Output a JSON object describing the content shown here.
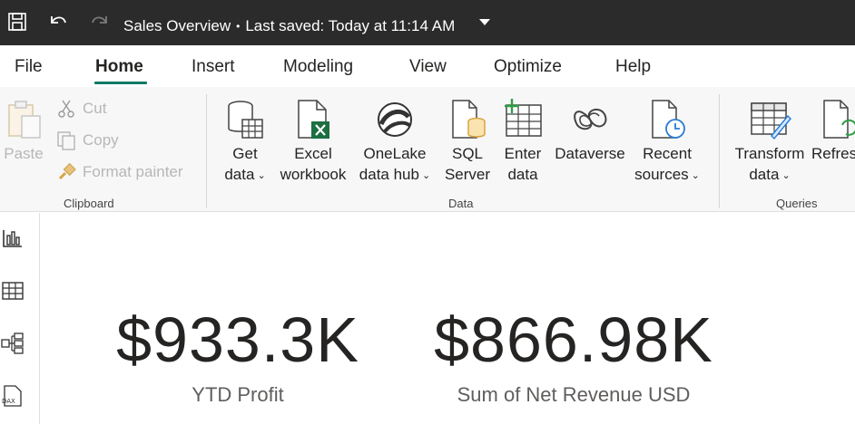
{
  "titlebar": {
    "doc_name": "Sales Overview",
    "separator": "•",
    "saved_text": "Last saved: Today at 11:14 AM"
  },
  "menu": {
    "tabs": [
      {
        "label": "File"
      },
      {
        "label": "Home",
        "active": true
      },
      {
        "label": "Insert"
      },
      {
        "label": "Modeling"
      },
      {
        "label": "View"
      },
      {
        "label": "Optimize"
      },
      {
        "label": "Help"
      }
    ]
  },
  "ribbon": {
    "clipboard": {
      "paste": "Paste",
      "cut": "Cut",
      "copy": "Copy",
      "format_painter": "Format painter",
      "group_label": "Clipboard"
    },
    "data": {
      "get_data": [
        "Get",
        "data"
      ],
      "excel": [
        "Excel",
        "workbook"
      ],
      "onelake": [
        "OneLake",
        "data hub"
      ],
      "sql": [
        "SQL",
        "Server"
      ],
      "enter_data": [
        "Enter",
        "data"
      ],
      "dataverse": "Dataverse",
      "recent": [
        "Recent",
        "sources"
      ],
      "group_label": "Data"
    },
    "queries": {
      "transform": [
        "Transform",
        "data"
      ],
      "refresh": "Refres",
      "group_label": "Queries"
    }
  },
  "kpis": [
    {
      "value": "$933.3K",
      "label": "YTD Profit"
    },
    {
      "value": "$866.98K",
      "label": "Sum of Net Revenue USD"
    }
  ],
  "colors": {
    "titlebar_bg": "#2b2b2b",
    "accent": "#117865",
    "excel_green": "#1d6f42"
  }
}
